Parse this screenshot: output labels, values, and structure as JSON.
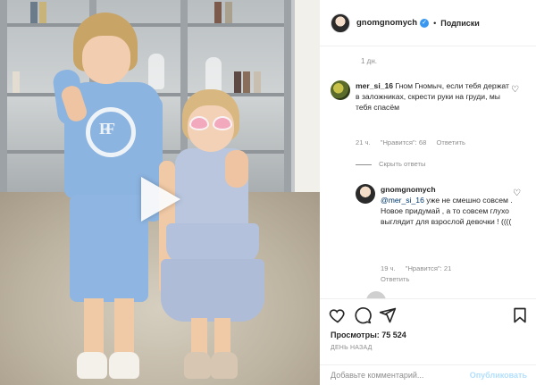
{
  "header": {
    "username": "gnomgnomych",
    "verified_glyph": "✓",
    "separator": "•",
    "follow_label": "Подписки"
  },
  "post": {
    "time_top": "1 дн."
  },
  "comments": [
    {
      "user": "mer_si_16",
      "text": "Гном Гномыч, если тебя держат в заложниках, скрести руки на груди, мы тебя спасём",
      "time": "21 ч.",
      "likes": "\"Нравится\": 68",
      "reply": "Ответить",
      "replies_toggle": "Скрыть ответы"
    },
    {
      "user": "gnomgnomych",
      "mention": "@mer_si_16",
      "text": "уже не смешно совсем . Новое придумай , а то совсем глухо выглядит для взрослой девочки ! ((((",
      "time": "19 ч.",
      "likes": "\"Нравится\": 21",
      "reply": "Ответить"
    }
  ],
  "stats": {
    "views": "Просмотры: 75 524",
    "days_ago": "ДЕНЬ НАЗАД"
  },
  "comment_box": {
    "placeholder": "Добавьте комментарий...",
    "publish_label": "Опубликовать"
  },
  "icons": {
    "like": "heart-icon",
    "comment": "comment-icon",
    "share": "share-icon",
    "save": "bookmark-icon",
    "play": "play-icon"
  },
  "colors": {
    "verified": "#3897f0",
    "publish_disabled": "#b2dffc",
    "muted_text": "#8e8e8e"
  }
}
